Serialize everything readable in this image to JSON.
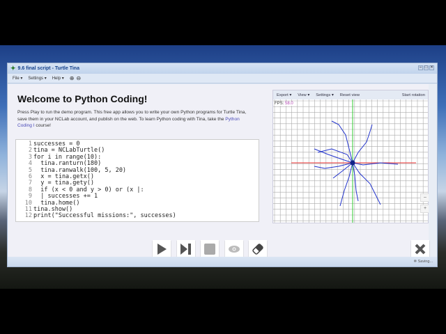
{
  "window": {
    "title": "9.6 final script - Turtle Tina",
    "min": "–",
    "max": "□",
    "close": "×"
  },
  "menu": {
    "file": "File ▾",
    "settings": "Settings ▾",
    "help": "Help ▾"
  },
  "main": {
    "heading": "Welcome to Python Coding!",
    "intro_before": "Press Play to run the demo program. This free app allows you to write your own Python programs for Turtle Tina, save them in your NCLab account, and publish on the web. To learn Python coding with Tina, take the ",
    "intro_link": "Python Coding I",
    "intro_after": " course!"
  },
  "code": [
    "successes = 0",
    "tina = NCLabTurtle()",
    "for i in range(10):",
    "  tina.ranturn(180)",
    "  tina.ranwalk(100, 5, 20)",
    "  x = tina.getx()",
    "  y = tina.gety()",
    "  if (x < 0 and y > 0) or (x |:",
    "  | successes += 1",
    "  tina.home()",
    "tina.show()",
    "print(\"Successful missions:\", successes)"
  ],
  "canvas": {
    "export": "Export ▾",
    "view": "View ▾",
    "settings": "Settings ▾",
    "reset": "Reset view",
    "rotation": "Start rotation",
    "fps_label": "FPS:",
    "fps_value": "58.0",
    "zoom_out": "–",
    "zoom_in": "+"
  },
  "status": {
    "text": "Saving..."
  }
}
